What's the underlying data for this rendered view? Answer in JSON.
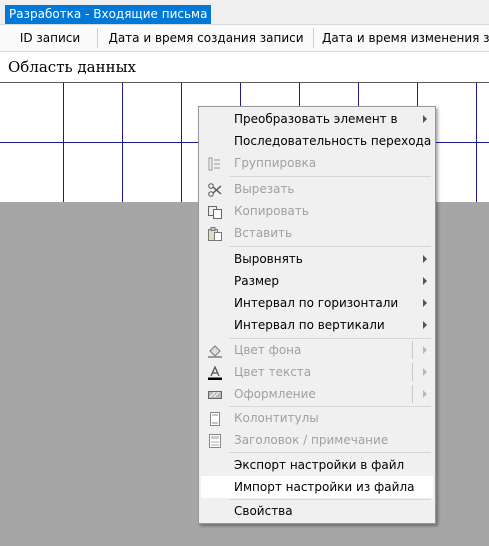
{
  "window": {
    "tab_title": "Разработка - Входящие письма"
  },
  "columns": [
    {
      "label": "ID записи"
    },
    {
      "label": "Дата и время создания записи"
    },
    {
      "label": "Дата и время изменения записи"
    }
  ],
  "section": {
    "title": "Область данных"
  },
  "context_menu": {
    "items": [
      {
        "label": "Преобразовать элемент в",
        "enabled": true,
        "submenu": true
      },
      {
        "label": "Последовательность перехода",
        "enabled": true
      },
      {
        "label": "Группировка",
        "enabled": false,
        "icon": "group-icon"
      },
      {
        "label": "Вырезать",
        "enabled": false,
        "icon": "scissors-icon"
      },
      {
        "label": "Копировать",
        "enabled": false,
        "icon": "copy-icon"
      },
      {
        "label": "Вставить",
        "enabled": false,
        "icon": "paste-icon"
      },
      {
        "label": "Выровнять",
        "enabled": true,
        "submenu": true
      },
      {
        "label": "Размер",
        "enabled": true,
        "submenu": true
      },
      {
        "label": "Интервал по горизонтали",
        "enabled": true,
        "submenu": true
      },
      {
        "label": "Интервал по вертикали",
        "enabled": true,
        "submenu": true
      },
      {
        "label": "Цвет фона",
        "enabled": false,
        "submenu": true,
        "icon": "fill-color-icon"
      },
      {
        "label": "Цвет текста",
        "enabled": false,
        "submenu": true,
        "icon": "font-color-icon"
      },
      {
        "label": "Оформление",
        "enabled": false,
        "submenu": true,
        "icon": "special-effect-icon"
      },
      {
        "label": "Колонтитулы",
        "enabled": false,
        "icon": "page-header-footer-icon"
      },
      {
        "label": "Заголовок / примечание",
        "enabled": false,
        "icon": "report-header-icon"
      },
      {
        "label": "Экспорт настройки в файл",
        "enabled": true
      },
      {
        "label": "Импорт настройки из файла",
        "enabled": true,
        "highlighted": true
      },
      {
        "label": "Свойства",
        "enabled": true
      }
    ]
  }
}
